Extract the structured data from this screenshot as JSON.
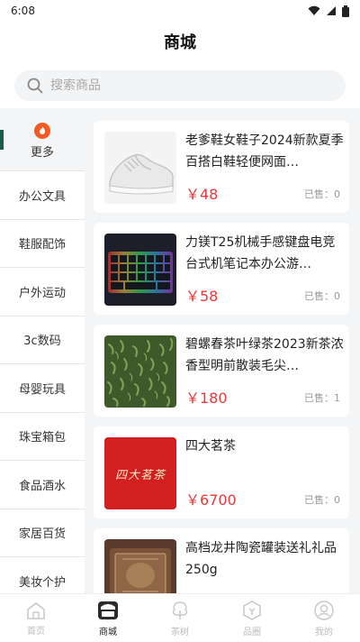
{
  "status_bar": {
    "time": "6:08"
  },
  "header": {
    "title": "商城"
  },
  "search": {
    "placeholder": "搜索商品"
  },
  "sidebar": {
    "items": [
      {
        "label": "更多",
        "active": true
      },
      {
        "label": "办公文具"
      },
      {
        "label": "鞋服配饰"
      },
      {
        "label": "户外运动"
      },
      {
        "label": "3c数码"
      },
      {
        "label": "母婴玩具"
      },
      {
        "label": "珠宝箱包"
      },
      {
        "label": "食品酒水"
      },
      {
        "label": "家居百货"
      },
      {
        "label": "美妆个护"
      }
    ]
  },
  "products": [
    {
      "title": "老爹鞋女鞋子2024新款夏季百搭白鞋轻便网面…",
      "price": "￥48",
      "sold": "已售：0"
    },
    {
      "title": "力镁T25机械手感键盘电竞台式机笔记本办公游…",
      "price": "￥58",
      "sold": "已售：0"
    },
    {
      "title": "碧螺春茶叶绿茶2023新茶浓香型明前散装毛尖…",
      "price": "￥180",
      "sold": "已售：1"
    },
    {
      "title": "四大茗茶",
      "price": "￥6700",
      "sold": "已售：0",
      "image_text": "四大茗茶"
    },
    {
      "title": "高档龙井陶瓷罐装送礼礼品250g",
      "price": "",
      "sold": ""
    }
  ],
  "tabbar": {
    "items": [
      {
        "label": "首页"
      },
      {
        "label": "商城",
        "active": true
      },
      {
        "label": "茶树"
      },
      {
        "label": "品圈"
      },
      {
        "label": "我的"
      }
    ]
  },
  "colors": {
    "accent": "#1d5a4b",
    "price": "#e5393b",
    "hot": "#f15a24"
  }
}
